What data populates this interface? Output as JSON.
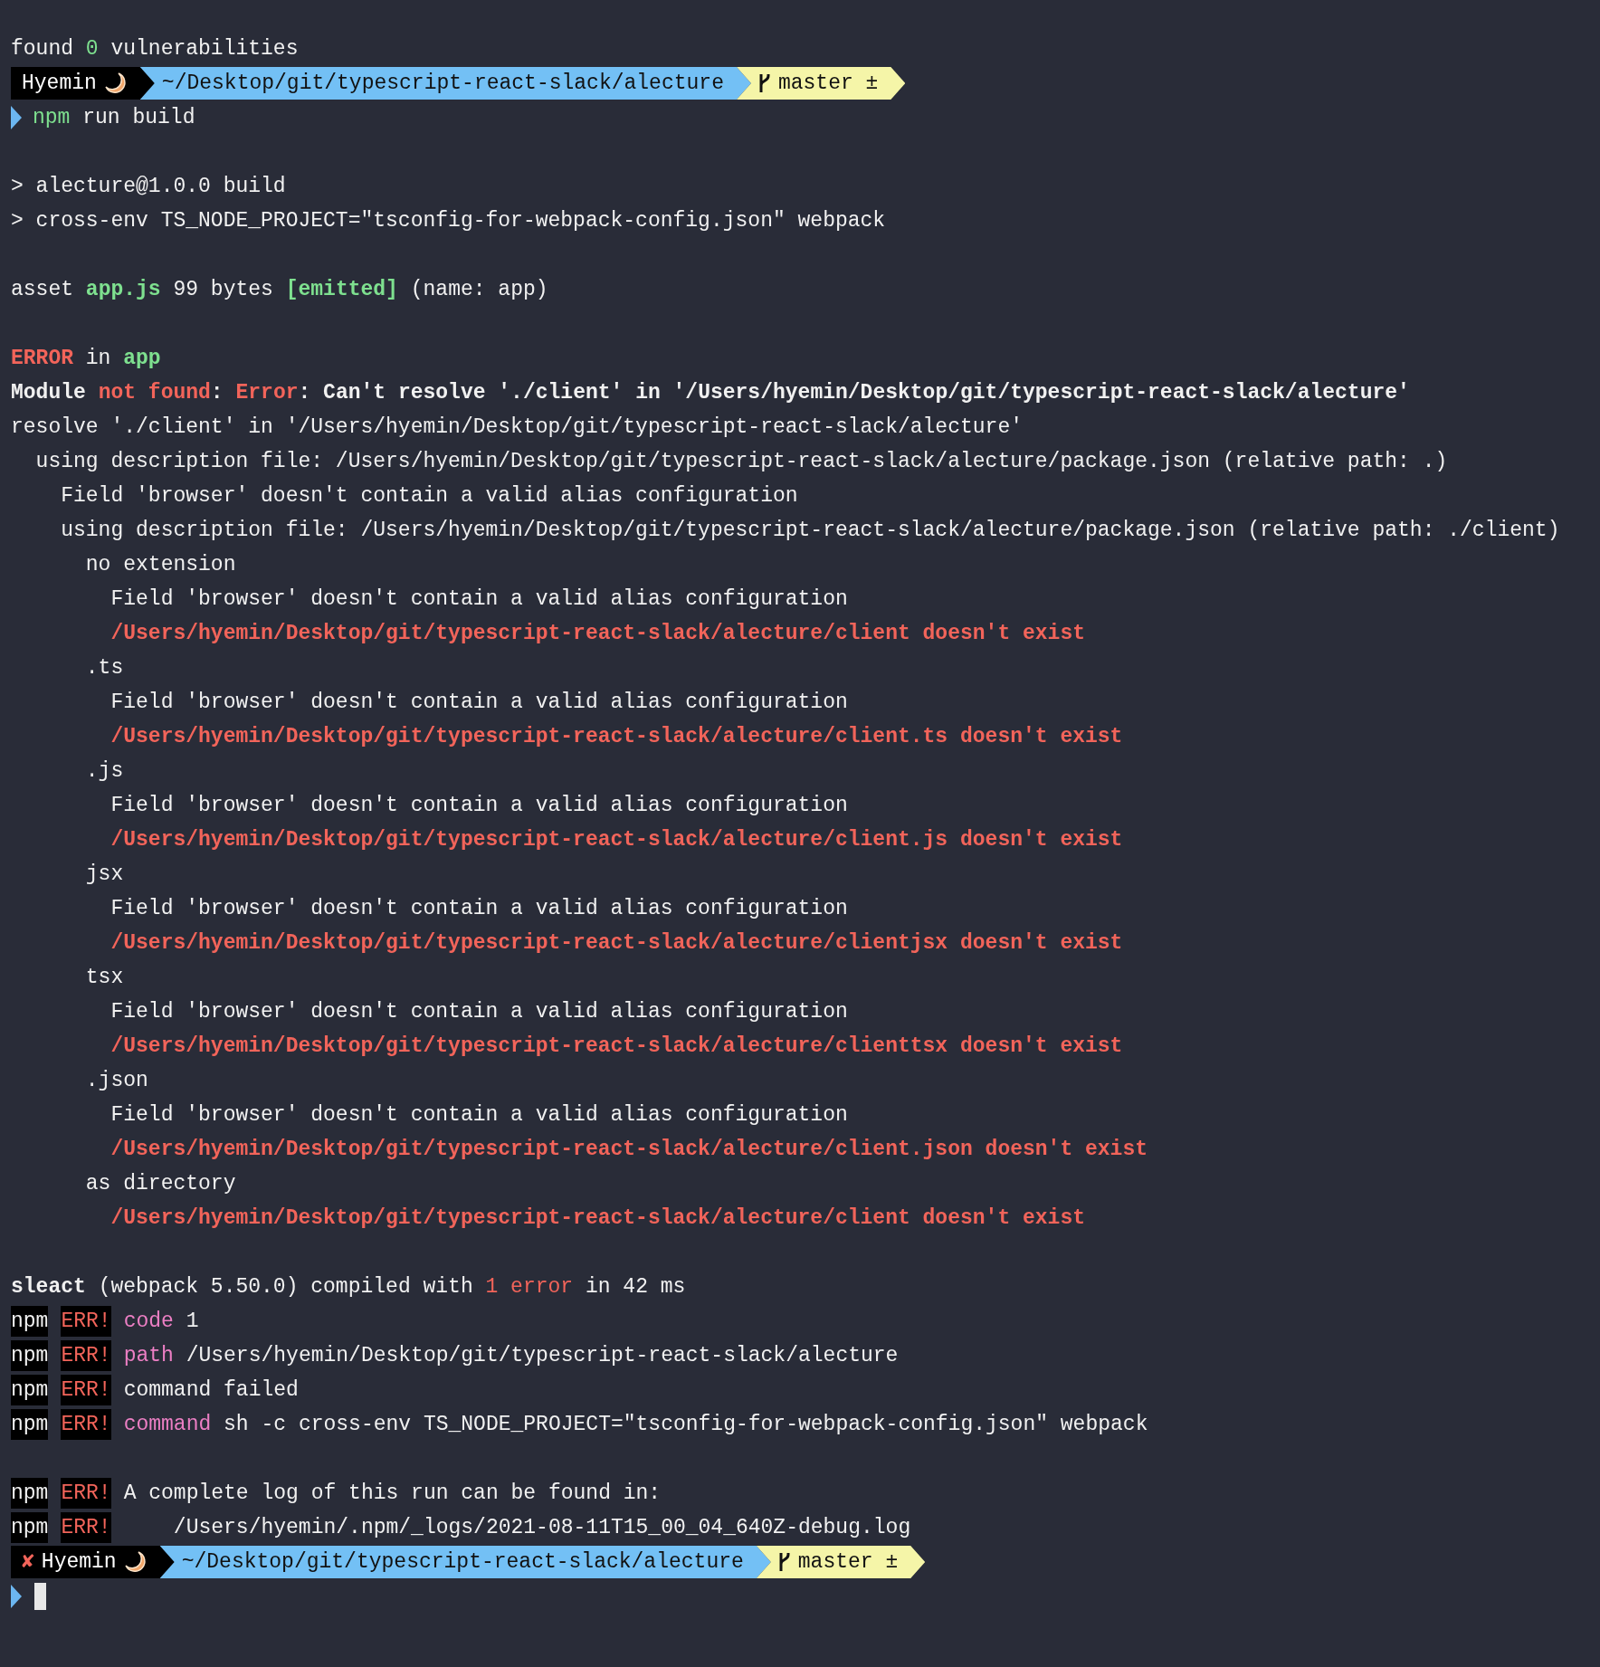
{
  "lines": [
    {
      "kind": "output",
      "segments": [
        {
          "text": "found ",
          "kind": "plain"
        },
        {
          "text": "0",
          "kind": "value"
        },
        {
          "text": " vulnerabilities",
          "kind": "plain"
        }
      ]
    },
    {
      "kind": "prompt",
      "user": "Hyemin",
      "path": "~/Desktop/git/typescript-react-slack/alecture",
      "branch": "master ±"
    },
    {
      "kind": "command",
      "cursor": false,
      "segments": [
        {
          "text": "npm",
          "kind": "value"
        },
        {
          "text": " run build",
          "kind": "plain"
        }
      ]
    },
    {
      "kind": "blank"
    },
    {
      "kind": "output",
      "segments": [
        {
          "text": "> alecture@1.0.0 build",
          "kind": "plain"
        }
      ]
    },
    {
      "kind": "output",
      "segments": [
        {
          "text": "> cross-env TS_NODE_PROJECT=\"tsconfig-for-webpack-config.json\" webpack",
          "kind": "plain"
        }
      ]
    },
    {
      "kind": "blank"
    },
    {
      "kind": "output",
      "segments": [
        {
          "text": "asset ",
          "kind": "plain"
        },
        {
          "text": "app.js",
          "kind": "name"
        },
        {
          "text": " 99 bytes ",
          "kind": "plain"
        },
        {
          "text": "[emitted]",
          "kind": "name"
        },
        {
          "text": " (name: app)",
          "kind": "plain"
        }
      ]
    },
    {
      "kind": "blank"
    },
    {
      "kind": "output",
      "segments": [
        {
          "text": "ERROR",
          "kind": "error"
        },
        {
          "text": " in ",
          "kind": "plain"
        },
        {
          "text": "app",
          "kind": "name"
        }
      ]
    },
    {
      "kind": "output",
      "segments": [
        {
          "text": "Module ",
          "kind": "strong"
        },
        {
          "text": "not found",
          "kind": "error"
        },
        {
          "text": ": ",
          "kind": "strong"
        },
        {
          "text": "Error",
          "kind": "error"
        },
        {
          "text": ": Can't resolve './client' in '/Users/hyemin/Desktop/git/typescript-react-slack/alecture'",
          "kind": "strong"
        }
      ]
    },
    {
      "kind": "output",
      "segments": [
        {
          "text": "resolve './client' in '/Users/hyemin/Desktop/git/typescript-react-slack/alecture'",
          "kind": "plain"
        }
      ]
    },
    {
      "kind": "output",
      "segments": [
        {
          "text": "  using description file: /Users/hyemin/Desktop/git/typescript-react-slack/alecture/package.json (relative path: .)",
          "kind": "plain"
        }
      ]
    },
    {
      "kind": "output",
      "segments": [
        {
          "text": "    Field 'browser' doesn't contain a valid alias configuration",
          "kind": "plain"
        }
      ]
    },
    {
      "kind": "output",
      "segments": [
        {
          "text": "    using description file: /Users/hyemin/Desktop/git/typescript-react-slack/alecture/package.json (relative path: ./client)",
          "kind": "plain"
        }
      ]
    },
    {
      "kind": "output",
      "segments": [
        {
          "text": "      no extension",
          "kind": "plain"
        }
      ]
    },
    {
      "kind": "output",
      "segments": [
        {
          "text": "        Field 'browser' doesn't contain a valid alias configuration",
          "kind": "plain"
        }
      ]
    },
    {
      "kind": "output",
      "segments": [
        {
          "text": "        /Users/hyemin/Desktop/git/typescript-react-slack/alecture/client doesn't exist",
          "kind": "error"
        }
      ]
    },
    {
      "kind": "output",
      "segments": [
        {
          "text": "      .ts",
          "kind": "plain"
        }
      ]
    },
    {
      "kind": "output",
      "segments": [
        {
          "text": "        Field 'browser' doesn't contain a valid alias configuration",
          "kind": "plain"
        }
      ]
    },
    {
      "kind": "output",
      "segments": [
        {
          "text": "        /Users/hyemin/Desktop/git/typescript-react-slack/alecture/client.ts doesn't exist",
          "kind": "error"
        }
      ]
    },
    {
      "kind": "output",
      "segments": [
        {
          "text": "      .js",
          "kind": "plain"
        }
      ]
    },
    {
      "kind": "output",
      "segments": [
        {
          "text": "        Field 'browser' doesn't contain a valid alias configuration",
          "kind": "plain"
        }
      ]
    },
    {
      "kind": "output",
      "segments": [
        {
          "text": "        /Users/hyemin/Desktop/git/typescript-react-slack/alecture/client.js doesn't exist",
          "kind": "error"
        }
      ]
    },
    {
      "kind": "output",
      "segments": [
        {
          "text": "      jsx",
          "kind": "plain"
        }
      ]
    },
    {
      "kind": "output",
      "segments": [
        {
          "text": "        Field 'browser' doesn't contain a valid alias configuration",
          "kind": "plain"
        }
      ]
    },
    {
      "kind": "output",
      "segments": [
        {
          "text": "        /Users/hyemin/Desktop/git/typescript-react-slack/alecture/clientjsx doesn't exist",
          "kind": "error"
        }
      ]
    },
    {
      "kind": "output",
      "segments": [
        {
          "text": "      tsx",
          "kind": "plain"
        }
      ]
    },
    {
      "kind": "output",
      "segments": [
        {
          "text": "        Field 'browser' doesn't contain a valid alias configuration",
          "kind": "plain"
        }
      ]
    },
    {
      "kind": "output",
      "segments": [
        {
          "text": "        /Users/hyemin/Desktop/git/typescript-react-slack/alecture/clienttsx doesn't exist",
          "kind": "error"
        }
      ]
    },
    {
      "kind": "output",
      "segments": [
        {
          "text": "      .json",
          "kind": "plain"
        }
      ]
    },
    {
      "kind": "output",
      "segments": [
        {
          "text": "        Field 'browser' doesn't contain a valid alias configuration",
          "kind": "plain"
        }
      ]
    },
    {
      "kind": "output",
      "segments": [
        {
          "text": "        /Users/hyemin/Desktop/git/typescript-react-slack/alecture/client.json doesn't exist",
          "kind": "error"
        }
      ]
    },
    {
      "kind": "output",
      "segments": [
        {
          "text": "      as directory",
          "kind": "plain"
        }
      ]
    },
    {
      "kind": "output",
      "segments": [
        {
          "text": "        /Users/hyemin/Desktop/git/typescript-react-slack/alecture/client doesn't exist",
          "kind": "error"
        }
      ]
    },
    {
      "kind": "blank"
    },
    {
      "kind": "output",
      "segments": [
        {
          "text": "sleact",
          "kind": "strong"
        },
        {
          "text": " (webpack 5.50.0) compiled with ",
          "kind": "plain"
        },
        {
          "text": "1 error",
          "kind": "count"
        },
        {
          "text": " in 42 ms",
          "kind": "plain"
        }
      ]
    },
    {
      "kind": "output",
      "segments": [
        {
          "text": "npm",
          "kind": "tool"
        },
        {
          "text": "ERR!",
          "kind": "severity"
        },
        {
          "text": "code",
          "kind": "key"
        },
        {
          "text": " 1",
          "kind": "plain"
        }
      ]
    },
    {
      "kind": "output",
      "segments": [
        {
          "text": "npm",
          "kind": "tool"
        },
        {
          "text": "ERR!",
          "kind": "severity"
        },
        {
          "text": "path",
          "kind": "key"
        },
        {
          "text": " /Users/hyemin/Desktop/git/typescript-react-slack/alecture",
          "kind": "plain"
        }
      ]
    },
    {
      "kind": "output",
      "segments": [
        {
          "text": "npm",
          "kind": "tool"
        },
        {
          "text": "ERR!",
          "kind": "severity"
        },
        {
          "text": "command failed",
          "kind": "plain"
        }
      ]
    },
    {
      "kind": "output",
      "segments": [
        {
          "text": "npm",
          "kind": "tool"
        },
        {
          "text": "ERR!",
          "kind": "severity"
        },
        {
          "text": "command",
          "kind": "key"
        },
        {
          "text": " sh -c cross-env TS_NODE_PROJECT=\"tsconfig-for-webpack-config.json\" webpack",
          "kind": "plain"
        }
      ]
    },
    {
      "kind": "blank"
    },
    {
      "kind": "output",
      "segments": [
        {
          "text": "npm",
          "kind": "tool"
        },
        {
          "text": "ERR!",
          "kind": "severity"
        },
        {
          "text": "A complete log of this run can be found in:",
          "kind": "plain"
        }
      ]
    },
    {
      "kind": "output",
      "segments": [
        {
          "text": "npm",
          "kind": "tool"
        },
        {
          "text": "ERR!",
          "kind": "severity"
        },
        {
          "text": "    /Users/hyemin/.npm/_logs/2021-08-11T15_00_04_640Z-debug.log",
          "kind": "plain"
        }
      ]
    },
    {
      "kind": "prompt",
      "mark": "✘",
      "user": "Hyemin",
      "path": "~/Desktop/git/typescript-react-slack/alecture",
      "branch": "master ±"
    },
    {
      "kind": "command",
      "cursor": true
    }
  ]
}
